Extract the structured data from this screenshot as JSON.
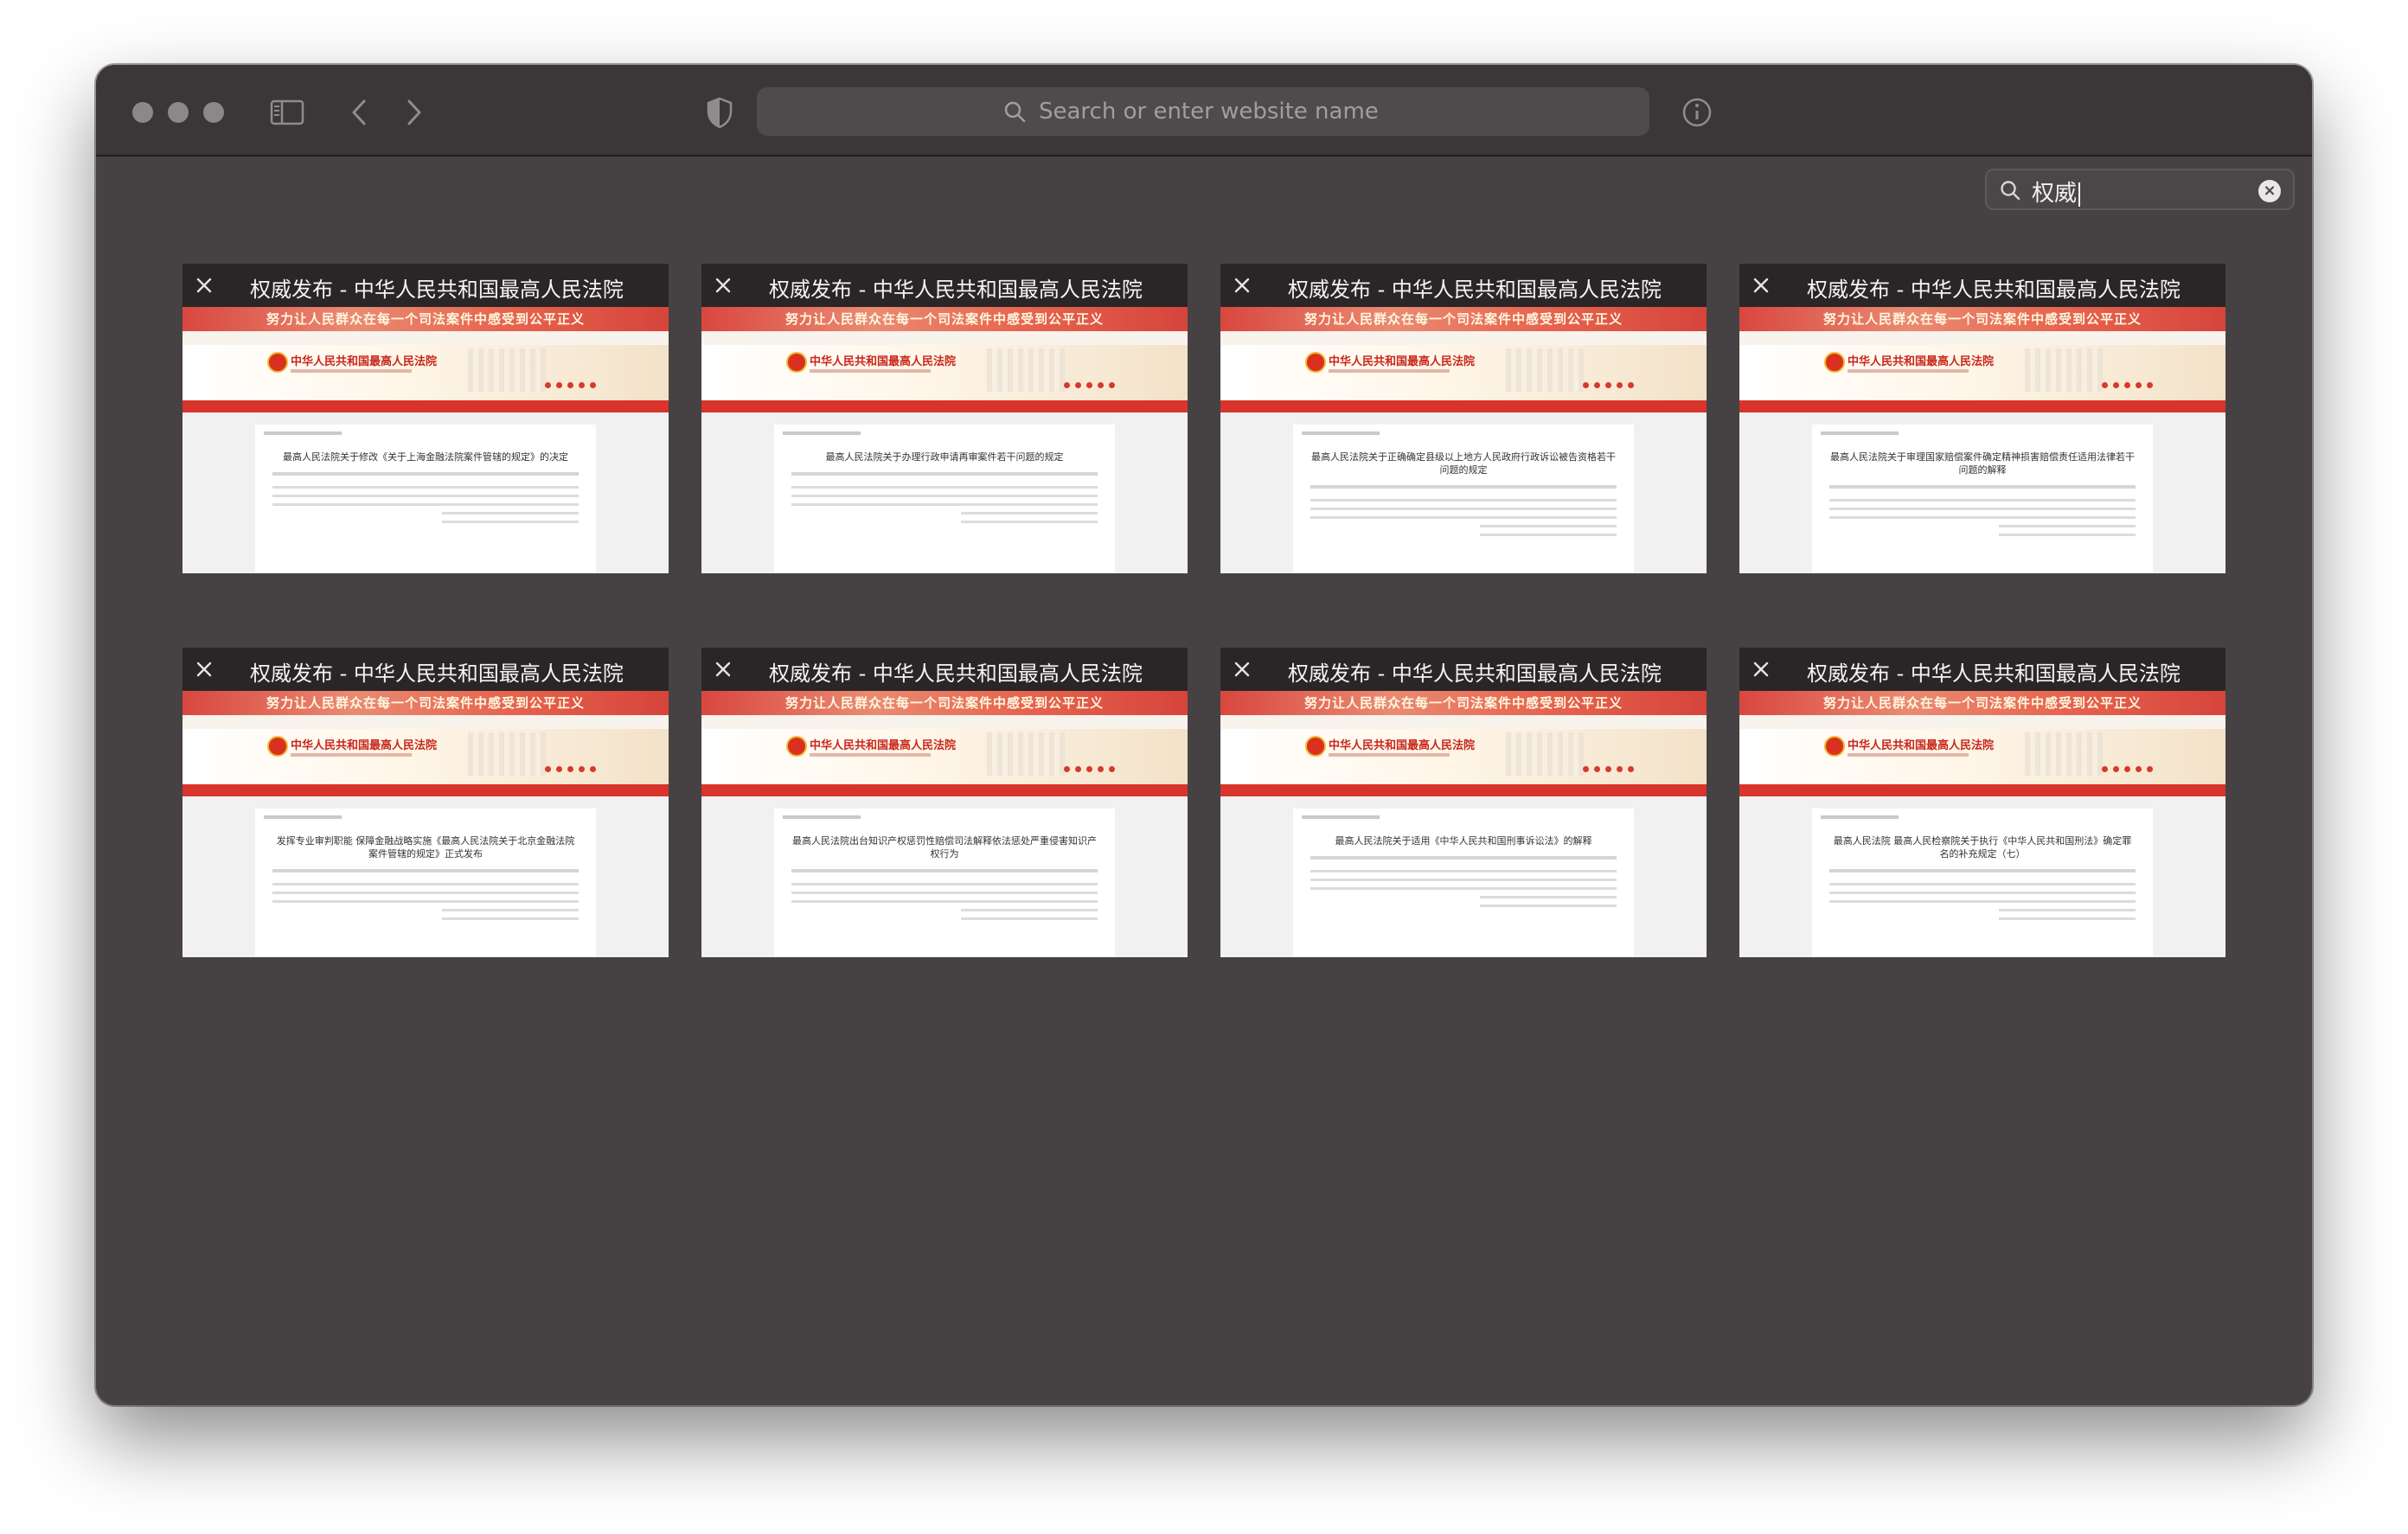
{
  "toolbar": {
    "address_placeholder": "Search or enter website name",
    "window_controls": [
      "close",
      "minimize",
      "zoom"
    ],
    "icons": [
      "sidebar-icon",
      "back-icon",
      "forward-icon",
      "privacy-shield-icon",
      "search-icon",
      "info-icon"
    ]
  },
  "tab_search": {
    "value": "权威",
    "icons": [
      "search-icon",
      "clear-icon"
    ]
  },
  "tabs": [
    {
      "title": "权威发布 - 中华人民共和国最高人民法院",
      "banner": "努力让人民群众在每一个司法案件中感受到公平正义",
      "site_name": "中华人民共和国最高人民法院",
      "doc_title": "最高人民法院关于修改《关于上海金融法院案件管辖的规定》的决定"
    },
    {
      "title": "权威发布 - 中华人民共和国最高人民法院",
      "banner": "努力让人民群众在每一个司法案件中感受到公平正义",
      "site_name": "中华人民共和国最高人民法院",
      "doc_title": "最高人民法院关于办理行政申请再审案件若干问题的规定"
    },
    {
      "title": "权威发布 - 中华人民共和国最高人民法院",
      "banner": "努力让人民群众在每一个司法案件中感受到公平正义",
      "site_name": "中华人民共和国最高人民法院",
      "doc_title": "最高人民法院关于正确确定县级以上地方人民政府行政诉讼被告资格若干问题的规定"
    },
    {
      "title": "权威发布 - 中华人民共和国最高人民法院",
      "banner": "努力让人民群众在每一个司法案件中感受到公平正义",
      "site_name": "中华人民共和国最高人民法院",
      "doc_title": "最高人民法院关于审理国家赔偿案件确定精神损害赔偿责任适用法律若干问题的解释"
    },
    {
      "title": "权威发布 - 中华人民共和国最高人民法院",
      "banner": "努力让人民群众在每一个司法案件中感受到公平正义",
      "site_name": "中华人民共和国最高人民法院",
      "doc_title": "发挥专业审判职能 保障金融战略实施《最高人民法院关于北京金融法院案件管辖的规定》正式发布"
    },
    {
      "title": "权威发布 - 中华人民共和国最高人民法院",
      "banner": "努力让人民群众在每一个司法案件中感受到公平正义",
      "site_name": "中华人民共和国最高人民法院",
      "doc_title": "最高人民法院出台知识产权惩罚性赔偿司法解释依法惩处严重侵害知识产权行为"
    },
    {
      "title": "权威发布 - 中华人民共和国最高人民法院",
      "banner": "努力让人民群众在每一个司法案件中感受到公平正义",
      "site_name": "中华人民共和国最高人民法院",
      "doc_title": "最高人民法院关于适用《中华人民共和国刑事诉讼法》的解释"
    },
    {
      "title": "权威发布 - 中华人民共和国最高人民法院",
      "banner": "努力让人民群众在每一个司法案件中感受到公平正义",
      "site_name": "中华人民共和国最高人民法院",
      "doc_title": "最高人民法院 最高人民检察院关于执行《中华人民共和国刑法》确定罪名的补充规定（七）"
    }
  ]
}
